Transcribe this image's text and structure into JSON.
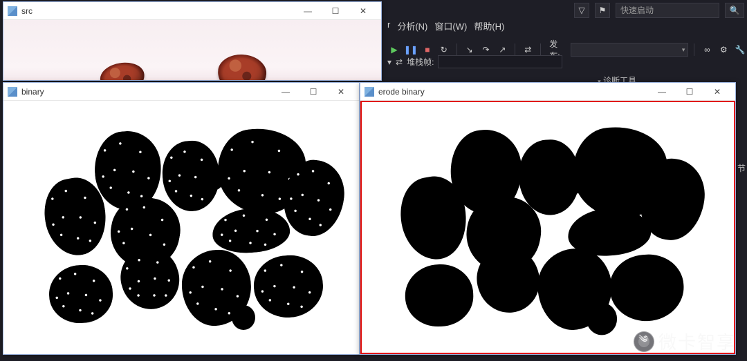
{
  "ide": {
    "menu": {
      "truncated": "r",
      "analysis": "分析(N)",
      "window": "窗口(W)",
      "help": "帮助(H)"
    },
    "quick_launch_placeholder": "快速启动",
    "publish_label": "发布:",
    "stack_frame_label": "堆栈帧:",
    "diagnostic_label": "诊断工具",
    "adjust_label": "节"
  },
  "windows": {
    "src": {
      "title": "src"
    },
    "binary": {
      "title": "binary"
    },
    "erode": {
      "title": "erode binary"
    }
  },
  "watermark": {
    "text": "微卡智享"
  },
  "glyphs": {
    "min": "—",
    "max": "☐",
    "close": "✕",
    "play": "▶",
    "pause": "❚❚",
    "stop": "■",
    "refresh": "↻",
    "down": "▾",
    "step_into": "↘",
    "step_over": "↷",
    "step_out": "↗",
    "filter": "▽",
    "flag": "⚑",
    "search": "🔍",
    "swap": "⇄",
    "gear": "⚙",
    "wrench": "🔧",
    "link": "∞"
  }
}
